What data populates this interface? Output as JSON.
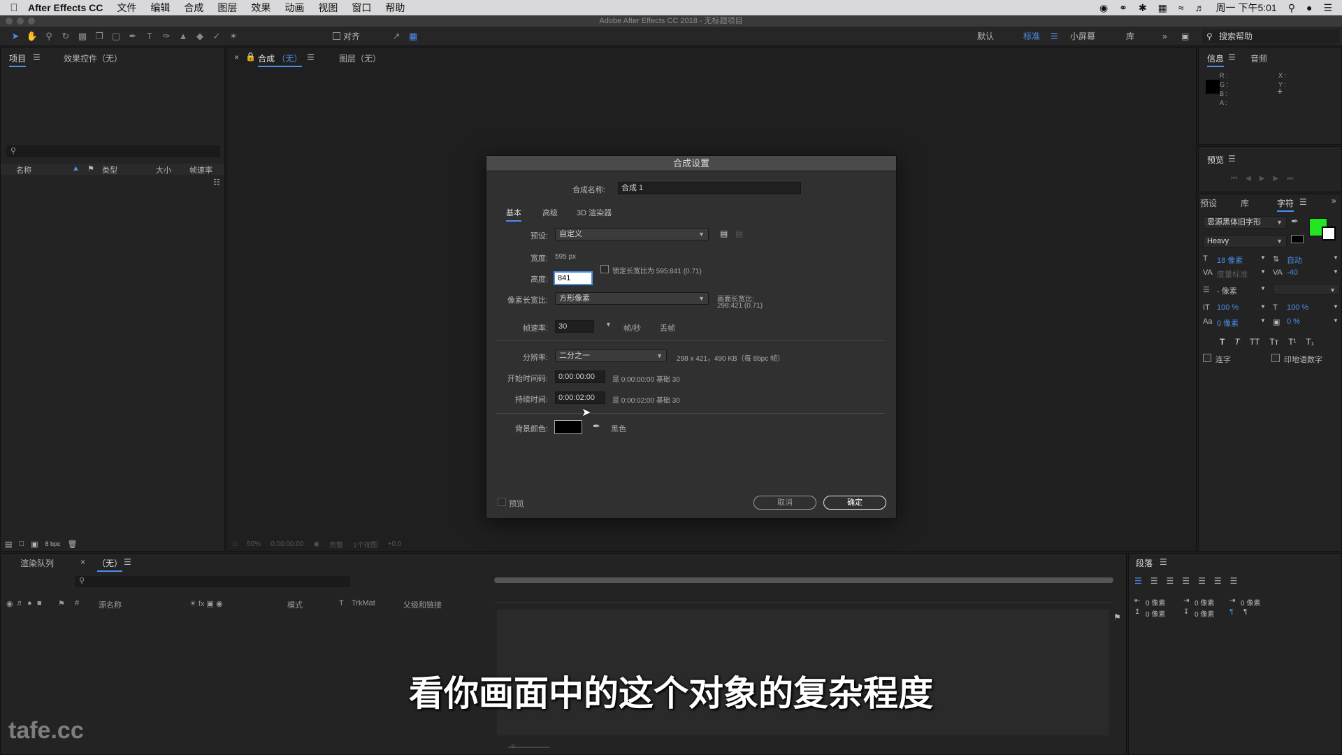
{
  "menubar": {
    "app": "After Effects CC",
    "items": [
      "文件",
      "编辑",
      "合成",
      "图层",
      "效果",
      "动画",
      "视图",
      "窗口",
      "帮助"
    ],
    "clock": "周一 下午5:01"
  },
  "window_title": "Adobe After Effects CC 2018 - 无标题项目",
  "toolbar": {
    "align_label": "对齐",
    "workspaces": [
      "默认",
      "标准",
      "小屏幕",
      "库"
    ],
    "active_workspace": "标准",
    "search_help": "搜索帮助"
  },
  "project_panel": {
    "tab_project": "项目",
    "tab_effects": "效果控件（无）",
    "columns": [
      "名称",
      "类型",
      "大小",
      "帧速率"
    ],
    "bpc": "8 bpc"
  },
  "viewer": {
    "tab_comp_prefix": "合成",
    "tab_comp_value": "（无）",
    "tab_layer": "图层（无）",
    "footer_zoom": "50%",
    "footer_time": "0:00:00:00",
    "footer_res": "完整",
    "footer_views": "1个视图",
    "footer_exposure": "+0.0"
  },
  "info_panel": {
    "tab_info": "信息",
    "tab_audio": "音频",
    "rgba": [
      "R :",
      "G :",
      "B :",
      "A :"
    ],
    "xy": [
      "X :",
      "Y :"
    ]
  },
  "preview_panel": {
    "tab": "预览"
  },
  "char_panel": {
    "tabs": [
      "预设",
      "库",
      "字符"
    ],
    "font": "思源黑体旧字形",
    "style": "Heavy",
    "size": "18 像素",
    "leading": "自动",
    "kerning": "度量标准",
    "tracking": "-40",
    "stroke": "- 像素",
    "vscale": "100 %",
    "hscale": "100 %",
    "baseline": "0 像素",
    "tsume": "0 %",
    "ligature": "连字",
    "hindi": "印地语数字",
    "fill_color": "#22e622"
  },
  "paragraph_panel": {
    "tab": "段落",
    "vals": [
      "0 像素",
      "0 像素",
      "0 像素",
      "0 像素",
      "0 像素"
    ]
  },
  "timeline": {
    "tab_render": "渲染队列",
    "tab_comp": "（无）",
    "columns": [
      "源名称",
      "模式",
      "T",
      "TrkMat",
      "父级和链接"
    ]
  },
  "dialog": {
    "title": "合成设置",
    "comp_name_label": "合成名称:",
    "comp_name": "合成 1",
    "tabs": [
      "基本",
      "高级",
      "3D 渲染器"
    ],
    "preset_label": "预设:",
    "preset": "自定义",
    "width_label": "宽度:",
    "width": "595 px",
    "lock_ratio": "锁定长宽比为 595:841 (0.71)",
    "height_label": "高度:",
    "height": "841",
    "pixel_aspect_label": "像素长宽比:",
    "pixel_aspect": "方形像素",
    "frame_aspect_label": "画面长宽比:",
    "frame_aspect_value": "298:421 (0.71)",
    "fps_label": "帧速率:",
    "fps": "30",
    "fps_unit": "帧/秒",
    "drop_frame": "丢帧",
    "resolution_label": "分辨率:",
    "resolution": "二分之一",
    "resolution_info": "298 x 421，490 KB（每 8bpc 帧）",
    "start_label": "开始时间码:",
    "start": "0:00:00:00",
    "start_info": "是 0:00:00:00  基础 30",
    "duration_label": "持续时间:",
    "duration": "0:00:02:00",
    "duration_info": "是 0:00:02:00  基础 30",
    "bg_label": "背景颜色:",
    "bg_name": "黑色",
    "bg_color": "#000000",
    "preview_cb": "预览",
    "cancel": "取消",
    "ok": "确定"
  },
  "subtitle": "看你画面中的这个对象的复杂程度",
  "watermark": "tafe.cc"
}
